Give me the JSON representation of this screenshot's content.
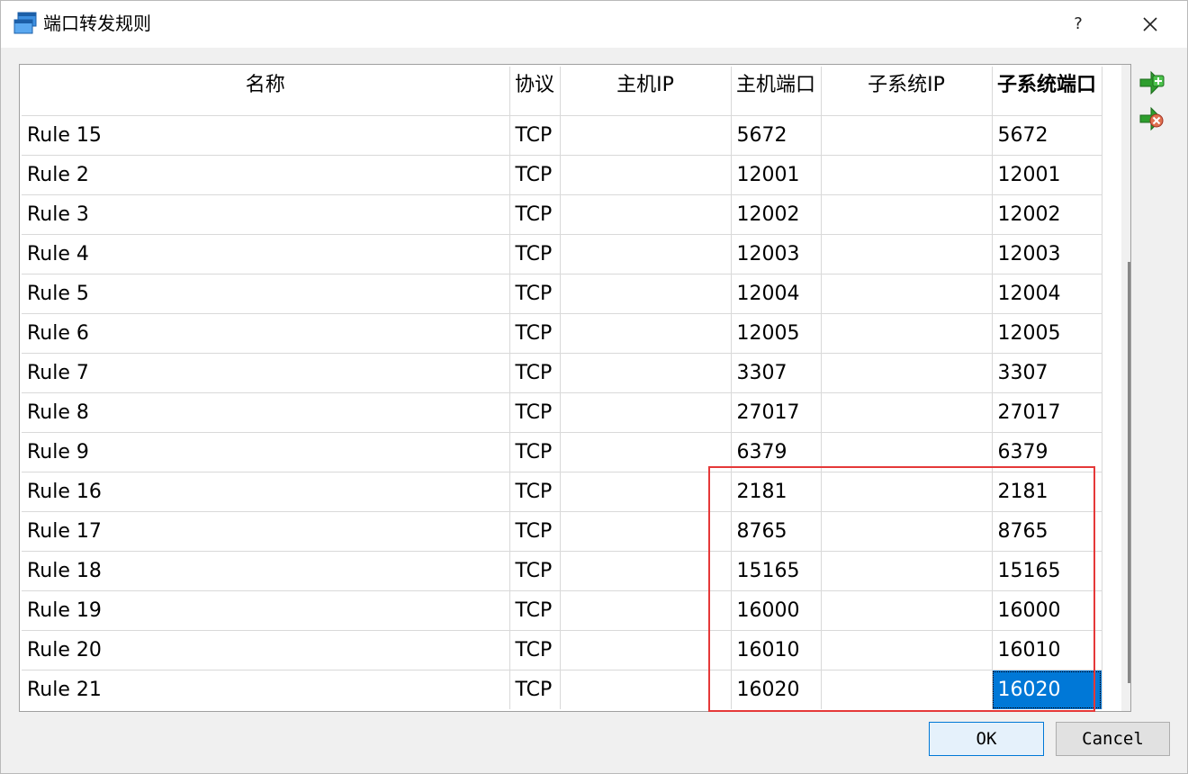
{
  "window": {
    "title": "端口转发规则",
    "help_glyph": "?"
  },
  "table": {
    "columns": [
      "名称",
      "协议",
      "主机IP",
      "主机端口",
      "子系统IP",
      "子系统端口"
    ],
    "rows": [
      [
        "Rule 15",
        "TCP",
        "",
        "5672",
        "",
        "5672"
      ],
      [
        "Rule 2",
        "TCP",
        "",
        "12001",
        "",
        "12001"
      ],
      [
        "Rule 3",
        "TCP",
        "",
        "12002",
        "",
        "12002"
      ],
      [
        "Rule 4",
        "TCP",
        "",
        "12003",
        "",
        "12003"
      ],
      [
        "Rule 5",
        "TCP",
        "",
        "12004",
        "",
        "12004"
      ],
      [
        "Rule 6",
        "TCP",
        "",
        "12005",
        "",
        "12005"
      ],
      [
        "Rule 7",
        "TCP",
        "",
        "3307",
        "",
        "3307"
      ],
      [
        "Rule 8",
        "TCP",
        "",
        "27017",
        "",
        "27017"
      ],
      [
        "Rule 9",
        "TCP",
        "",
        "6379",
        "",
        "6379"
      ],
      [
        "Rule 16",
        "TCP",
        "",
        "2181",
        "",
        "2181"
      ],
      [
        "Rule 17",
        "TCP",
        "",
        "8765",
        "",
        "8765"
      ],
      [
        "Rule 18",
        "TCP",
        "",
        "15165",
        "",
        "15165"
      ],
      [
        "Rule 19",
        "TCP",
        "",
        "16000",
        "",
        "16000"
      ],
      [
        "Rule 20",
        "TCP",
        "",
        "16010",
        "",
        "16010"
      ],
      [
        "Rule 21",
        "TCP",
        "",
        "16020",
        "",
        "16020"
      ]
    ]
  },
  "side_buttons": {
    "add_icon": "add-rule-icon",
    "remove_icon": "remove-rule-icon"
  },
  "buttons": {
    "ok": "OK",
    "cancel": "Cancel"
  },
  "colors": {
    "selection": "#0078d7",
    "highlight_border": "#e53939",
    "add_green": "#2e9e2e",
    "remove_red": "#d9443a"
  }
}
